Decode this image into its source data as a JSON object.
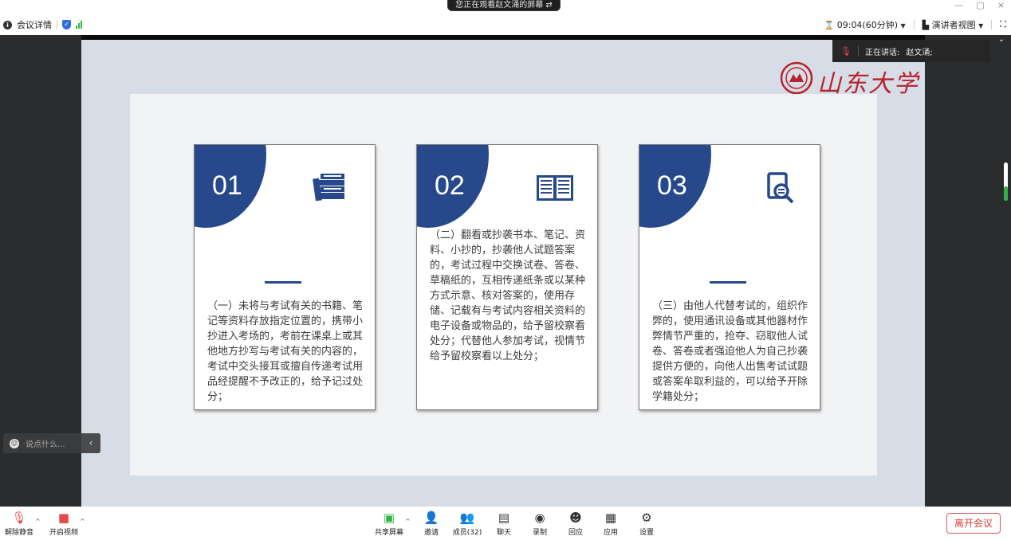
{
  "banner": {
    "text": "您正在观看赵文涌的屏幕",
    "icon": "exit-share-icon"
  },
  "window_controls": {
    "minimize": "—",
    "restore": "▢",
    "close": "×"
  },
  "infobar": {
    "meeting_details": "会议详情",
    "timer": "09:04(60分钟)",
    "view_mode": "演讲者视图"
  },
  "speaking": {
    "label": "正在讲话:",
    "speaker": "赵文涌;"
  },
  "logo": {
    "text": "山东大学",
    "color": "#b8222c"
  },
  "slide": {
    "accent_color": "#27498b",
    "cards": [
      {
        "number": "01",
        "icon": "books-icon",
        "text": "（一）未将与考试有关的书籍、笔记等资料存放指定位置的，携带小抄进入考场的，考前在课桌上或其他地方抄写与考试有关的内容的，考试中交头接耳或擅自传递考试用品经提醒不予改正的，给予记过处分；"
      },
      {
        "number": "02",
        "icon": "open-book-icon",
        "text": "（二）翻看或抄袭书本、笔记、资料、小抄的，抄袭他人试题答案的，考试过程中交换试卷、答卷、草稿纸的，互相传递纸条或以某种方式示意、核对答案的，使用存储、记载有与考试内容相关资料的电子设备或物品的，给予留校察看处分；代替他人参加考试，视情节给予留校察看以上处分；"
      },
      {
        "number": "03",
        "icon": "document-search-icon",
        "text": "（三）由他人代替考试的，组织作弊的，使用通讯设备或其他器材作弊情节严重的，抢夺、窃取他人试卷、答卷或者强迫他人为自己抄袭提供方便的，向他人出售考试试题或答案牟取利益的，可以给予开除学籍处分；"
      }
    ]
  },
  "chat": {
    "placeholder": "说点什么..."
  },
  "toolbar": {
    "unmute": "解除静音",
    "start_video": "开启视频",
    "share_screen": "共享屏幕",
    "invite": "邀请",
    "members": "成员(32)",
    "chat": "聊天",
    "record": "录制",
    "reactions": "回应",
    "apps": "应用",
    "settings": "设置",
    "leave": "离开会议"
  }
}
